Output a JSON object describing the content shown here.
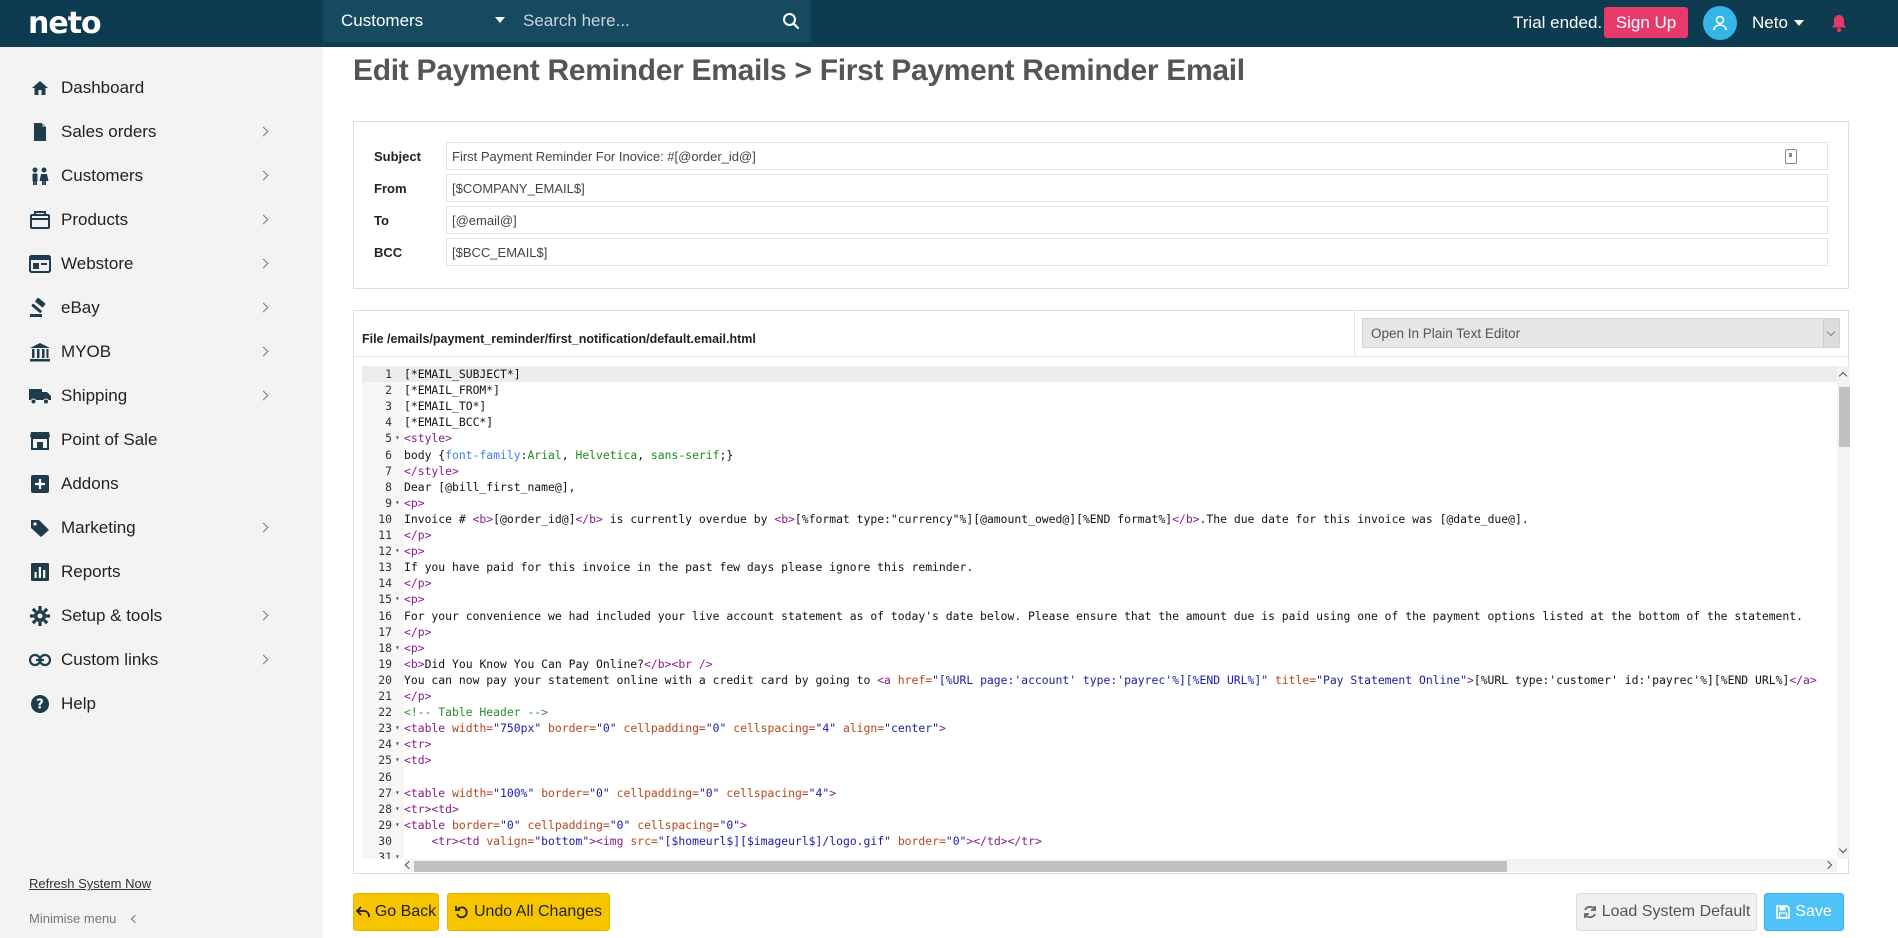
{
  "app": {
    "logo": "neto"
  },
  "search": {
    "scope": "Customers",
    "placeholder": "Search here..."
  },
  "topbar": {
    "trial_text": "Trial ended.",
    "signup_label": "Sign Up",
    "user_name": "Neto"
  },
  "sidebar": {
    "items": [
      {
        "label": "Dashboard",
        "icon": "home-icon",
        "has_children": false
      },
      {
        "label": "Sales orders",
        "icon": "document-icon",
        "has_children": true
      },
      {
        "label": "Customers",
        "icon": "users-icon",
        "has_children": true
      },
      {
        "label": "Products",
        "icon": "box-icon",
        "has_children": true
      },
      {
        "label": "Webstore",
        "icon": "browser-icon",
        "has_children": true
      },
      {
        "label": "eBay",
        "icon": "gavel-icon",
        "has_children": true
      },
      {
        "label": "MYOB",
        "icon": "bank-icon",
        "has_children": true
      },
      {
        "label": "Shipping",
        "icon": "truck-icon",
        "has_children": true
      },
      {
        "label": "Point of Sale",
        "icon": "store-icon",
        "has_children": false
      },
      {
        "label": "Addons",
        "icon": "plus-square-icon",
        "has_children": false
      },
      {
        "label": "Marketing",
        "icon": "tag-icon",
        "has_children": true
      },
      {
        "label": "Reports",
        "icon": "chart-icon",
        "has_children": false
      },
      {
        "label": "Setup & tools",
        "icon": "gear-icon",
        "has_children": true
      },
      {
        "label": "Custom links",
        "icon": "link-icon",
        "has_children": true
      },
      {
        "label": "Help",
        "icon": "help-icon",
        "has_children": false
      }
    ],
    "refresh_label": "Refresh System Now",
    "minimise_label": "Minimise menu"
  },
  "page": {
    "title": "Edit Payment Reminder Emails > First Payment Reminder Email"
  },
  "headers": {
    "subject_label": "Subject",
    "subject_value": "First Payment Reminder For Inovice: #[@order_id@]",
    "from_label": "From",
    "from_value": "[$COMPANY_EMAIL$]",
    "to_label": "To",
    "to_value": "[@email@]",
    "bcc_label": "BCC",
    "bcc_value": "[$BCC_EMAIL$]"
  },
  "editor": {
    "file_path": "File /emails/payment_reminder/first_notification/default.email.html",
    "editor_select": "Open In Plain Text Editor",
    "lines": [
      {
        "n": "1",
        "fold": false,
        "html": "[*EMAIL_SUBJECT*]"
      },
      {
        "n": "2",
        "fold": false,
        "html": "[*EMAIL_FROM*]"
      },
      {
        "n": "3",
        "fold": false,
        "html": "[*EMAIL_TO*]"
      },
      {
        "n": "4",
        "fold": false,
        "html": "[*EMAIL_BCC*]"
      },
      {
        "n": "5",
        "fold": true,
        "html": "<span class='t'>&lt;style&gt;</span>"
      },
      {
        "n": "6",
        "fold": false,
        "html": "body {<span class='p'>font-family</span>:<span class='v'>Arial</span>, <span class='v'>Helvetica</span>, <span class='v'>sans-serif</span>;}"
      },
      {
        "n": "7",
        "fold": false,
        "html": "<span class='t'>&lt;/style&gt;</span>"
      },
      {
        "n": "8",
        "fold": false,
        "html": "Dear [@bill_first_name@],"
      },
      {
        "n": "9",
        "fold": true,
        "html": "<span class='t'>&lt;p&gt;</span>"
      },
      {
        "n": "10",
        "fold": false,
        "html": "Invoice # <span class='t'>&lt;b&gt;</span>[@order_id@]<span class='t'>&lt;/b&gt;</span> is currently overdue by <span class='t'>&lt;b&gt;</span>[%format type:\"currency\"%][@amount_owed@][%END format%]<span class='t'>&lt;/b&gt;</span>.The due date for this invoice was [@date_due@]."
      },
      {
        "n": "11",
        "fold": false,
        "html": "<span class='t'>&lt;/p&gt;</span>"
      },
      {
        "n": "12",
        "fold": true,
        "html": "<span class='t'>&lt;p&gt;</span>"
      },
      {
        "n": "13",
        "fold": false,
        "html": "If you have paid for this invoice in the past few days please ignore this reminder."
      },
      {
        "n": "14",
        "fold": false,
        "html": "<span class='t'>&lt;/p&gt;</span>"
      },
      {
        "n": "15",
        "fold": true,
        "html": "<span class='t'>&lt;p&gt;</span>"
      },
      {
        "n": "16",
        "fold": false,
        "html": "For your convenience we had included your live account statement as of today's date below. Please ensure that the amount due is paid using one of the payment options listed at the bottom of the statement."
      },
      {
        "n": "17",
        "fold": false,
        "html": "<span class='t'>&lt;/p&gt;</span>"
      },
      {
        "n": "18",
        "fold": true,
        "html": "<span class='t'>&lt;p&gt;</span>"
      },
      {
        "n": "19",
        "fold": false,
        "html": "<span class='t'>&lt;b&gt;</span>Did You Know You Can Pay Online?<span class='t'>&lt;/b&gt;&lt;br /&gt;</span>"
      },
      {
        "n": "20",
        "fold": false,
        "html": "You can now pay your statement online with a credit card by going to <span class='t'>&lt;a</span> <span class='a'>href=</span><span class='s'>\"[%URL page:'account' type:'payrec'%][%END URL%]\"</span> <span class='a'>title=</span><span class='s'>\"Pay Statement Online\"</span><span class='t'>&gt;</span>[%URL type:'customer' id:'payrec'%][%END URL%]<span class='t'>&lt;/a&gt;</span>"
      },
      {
        "n": "21",
        "fold": false,
        "html": "<span class='t'>&lt;/p&gt;</span>"
      },
      {
        "n": "22",
        "fold": false,
        "html": "<span class='c'>&lt;!-- Table Header --&gt;</span>"
      },
      {
        "n": "23",
        "fold": true,
        "html": "<span class='t'>&lt;table</span> <span class='a'>width=</span><span class='s'>\"750px\"</span> <span class='a'>border=</span><span class='s'>\"0\"</span> <span class='a'>cellpadding=</span><span class='s'>\"0\"</span> <span class='a'>cellspacing=</span><span class='s'>\"4\"</span> <span class='a'>align=</span><span class='s'>\"center\"</span><span class='t'>&gt;</span>"
      },
      {
        "n": "24",
        "fold": true,
        "html": "<span class='t'>&lt;tr&gt;</span>"
      },
      {
        "n": "25",
        "fold": true,
        "html": "<span class='t'>&lt;td&gt;</span>"
      },
      {
        "n": "26",
        "fold": false,
        "html": ""
      },
      {
        "n": "27",
        "fold": true,
        "html": "<span class='t'>&lt;table</span> <span class='a'>width=</span><span class='s'>\"100%\"</span> <span class='a'>border=</span><span class='s'>\"0\"</span> <span class='a'>cellpadding=</span><span class='s'>\"0\"</span> <span class='a'>cellspacing=</span><span class='s'>\"4\"</span><span class='t'>&gt;</span>"
      },
      {
        "n": "28",
        "fold": true,
        "html": "<span class='t'>&lt;tr&gt;&lt;td&gt;</span>"
      },
      {
        "n": "29",
        "fold": true,
        "html": "<span class='t'>&lt;table</span> <span class='a'>border=</span><span class='s'>\"0\"</span> <span class='a'>cellpadding=</span><span class='s'>\"0\"</span> <span class='a'>cellspacing=</span><span class='s'>\"0\"</span><span class='t'>&gt;</span>"
      },
      {
        "n": "30",
        "fold": false,
        "html": "    <span class='t'>&lt;tr&gt;&lt;td</span> <span class='a'>valign=</span><span class='s'>\"bottom\"</span><span class='t'>&gt;&lt;img</span> <span class='a'>src=</span><span class='s'>\"[$homeurl$][$imageurl$]/logo.gif\"</span> <span class='a'>border=</span><span class='s'>\"0\"</span><span class='t'>&gt;&lt;/td&gt;&lt;/tr&gt;</span>"
      },
      {
        "n": "31",
        "fold": true,
        "html": ""
      }
    ]
  },
  "actions": {
    "go_back": "Go Back",
    "undo": "Undo All Changes",
    "load_default": "Load System Default",
    "save": "Save"
  }
}
